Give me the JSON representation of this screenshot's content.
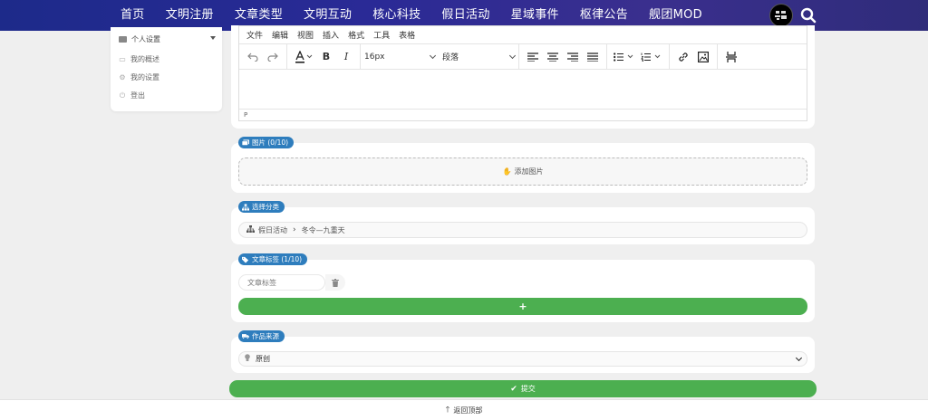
{
  "nav": {
    "items": [
      "首页",
      "文明注册",
      "文章类型",
      "文明互动",
      "核心科技",
      "假日活动",
      "星域事件",
      "枢律公告",
      "舰团MOD"
    ],
    "logo_icon": "avatar-logo",
    "search_icon": "search-icon"
  },
  "sidebar": {
    "header": "个人设置",
    "items": [
      {
        "label": "我的概述",
        "icon": "id-card-icon"
      },
      {
        "label": "我的设置",
        "icon": "gear-icon"
      },
      {
        "label": "登出",
        "icon": "power-icon"
      }
    ]
  },
  "editor": {
    "menu": [
      "文件",
      "编辑",
      "视图",
      "插入",
      "格式",
      "工具",
      "表格"
    ],
    "font_size": "16px",
    "block_format": "段落",
    "status_path": "P"
  },
  "images": {
    "badge": "图片 (0/10)",
    "add_label": "添加图片"
  },
  "category": {
    "badge": "选择分类",
    "path": [
      "假日活动",
      "冬令—九重天"
    ]
  },
  "tags": {
    "badge": "文章标签 (1/10)",
    "placeholder": "文章标签",
    "add_label": "+"
  },
  "source": {
    "badge": "作品来源",
    "selected": "原创"
  },
  "submit_label": "提交",
  "back_to_top": "返回顶部",
  "colors": {
    "nav_bg": "#2a2a96",
    "badge_blue": "#2e7dbd",
    "green": "#4caf50",
    "page_bg": "#efefef"
  }
}
